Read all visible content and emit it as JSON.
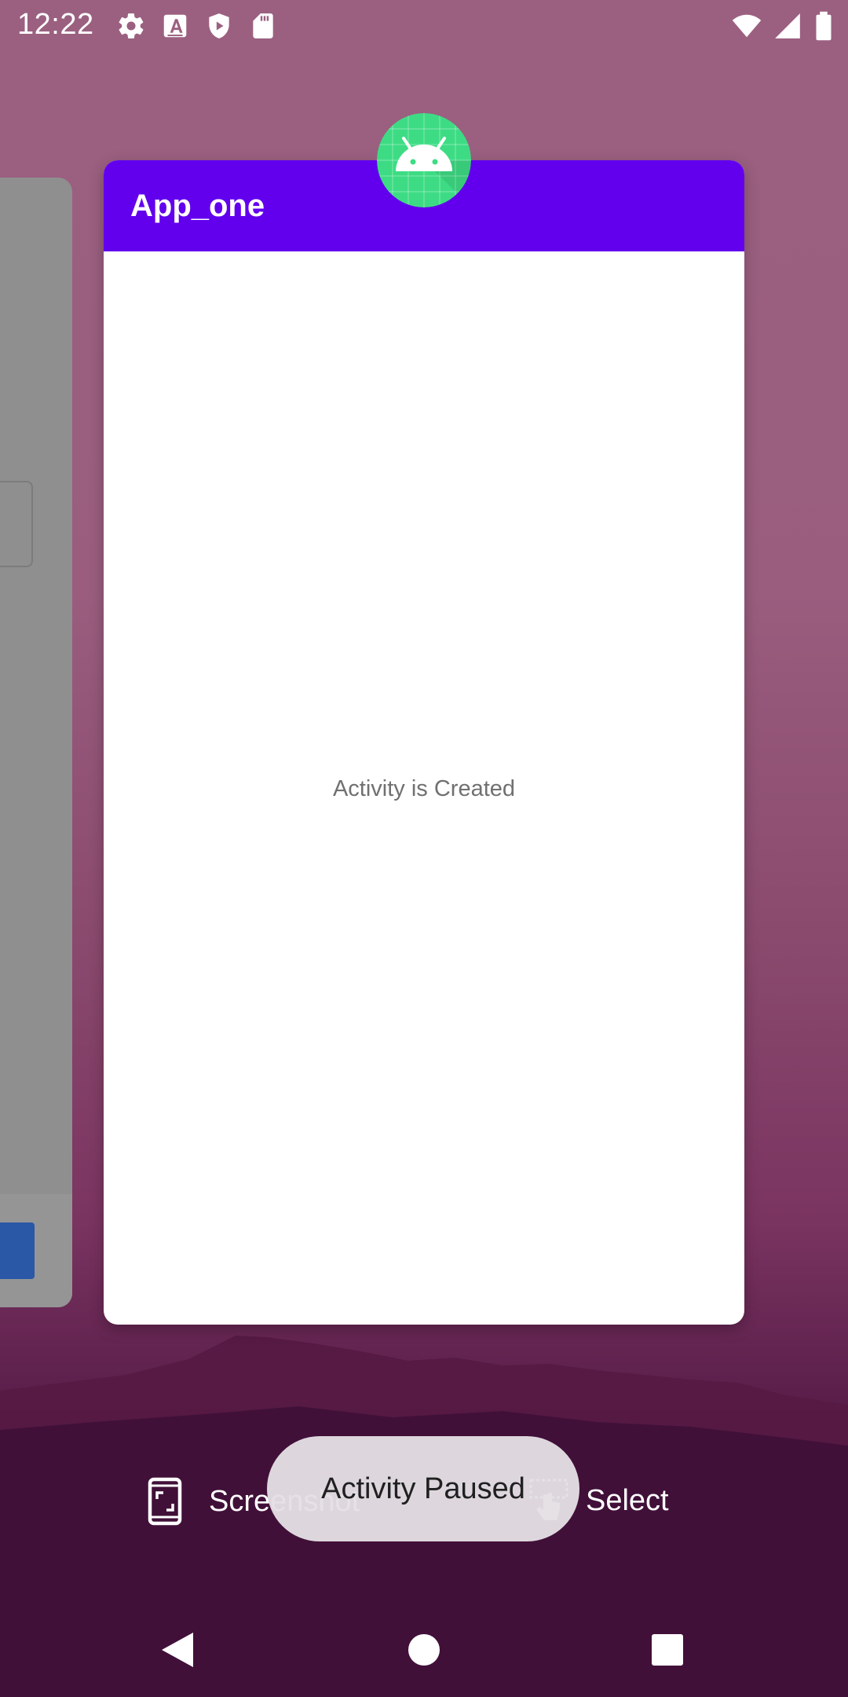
{
  "status_bar": {
    "time": "12:22",
    "icons_left": [
      "settings-icon",
      "font-a-icon",
      "play-protect-icon",
      "sd-card-icon"
    ],
    "icons_right": [
      "wifi-icon",
      "signal-icon",
      "battery-icon"
    ]
  },
  "recents": {
    "card": {
      "app_title": "App_one",
      "body_text": "Activity is Created",
      "app_bar_color": "#6200ee",
      "icon": "android-app-icon"
    },
    "actions": {
      "screenshot_label": "Screenshot",
      "select_label": "Select"
    }
  },
  "toast": {
    "text": "Activity Paused"
  },
  "nav_bar": {
    "buttons": [
      "back-icon",
      "home-icon",
      "recents-icon"
    ]
  }
}
